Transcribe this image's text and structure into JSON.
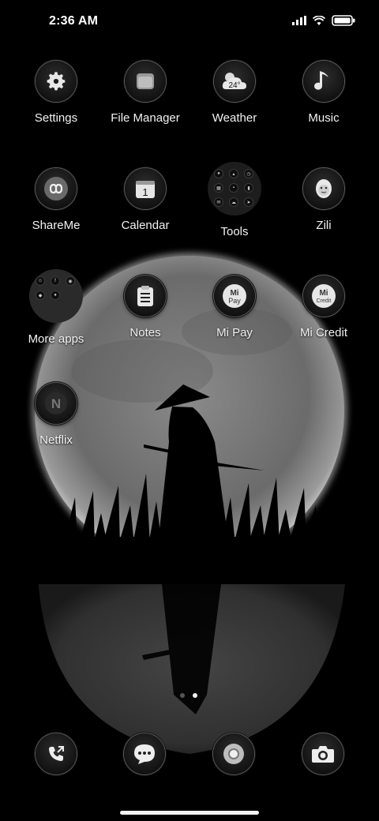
{
  "status_bar": {
    "time": "2:36 AM",
    "icons": [
      "signal-icon",
      "wifi-icon",
      "battery-icon"
    ]
  },
  "apps": {
    "row1": [
      {
        "label": "Settings",
        "icon": "gear-icon"
      },
      {
        "label": "File Manager",
        "icon": "folder-icon"
      },
      {
        "label": "Weather",
        "icon": "cloud-sun-icon",
        "badge": "24°"
      },
      {
        "label": "Music",
        "icon": "music-note-icon"
      }
    ],
    "row2": [
      {
        "label": "ShareMe",
        "icon": "infinity-icon"
      },
      {
        "label": "Calendar",
        "icon": "calendar-icon",
        "badge": "1"
      },
      {
        "label": "Tools",
        "icon": "tools-folder-icon"
      },
      {
        "label": "Zili",
        "icon": "zili-face-icon"
      }
    ],
    "row3": [
      {
        "label": "More apps",
        "icon": "more-apps-folder-icon"
      },
      {
        "label": "Notes",
        "icon": "notepad-icon"
      },
      {
        "label": "Mi Pay",
        "icon": "mi-pay-icon",
        "badge_top": "Mi",
        "badge_bottom": "Pay"
      },
      {
        "label": "Mi Credit",
        "icon": "mi-credit-icon",
        "badge_top": "Mi",
        "badge_bottom": "Credit"
      }
    ],
    "row4": [
      {
        "label": "Netflix",
        "icon": "netflix-icon",
        "badge": "N"
      }
    ]
  },
  "pager": {
    "pages": 2,
    "active": 2
  },
  "dock": [
    {
      "icon": "phone-icon"
    },
    {
      "icon": "messages-icon"
    },
    {
      "icon": "chrome-icon"
    },
    {
      "icon": "camera-icon"
    }
  ]
}
